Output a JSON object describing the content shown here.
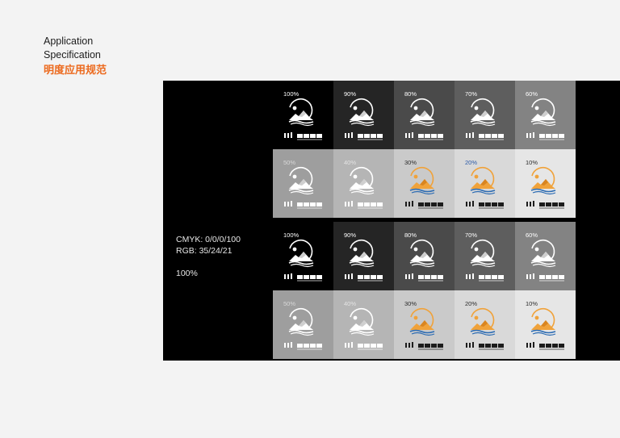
{
  "heading": {
    "line1": "Application",
    "line2": "Specification",
    "line3": "明度应用规范"
  },
  "info": {
    "cmyk": "CMYK: 0/0/0/100",
    "rgb": "RGB: 35/24/21",
    "percent": "100%"
  },
  "colors": {
    "accent": "#ec6a1e",
    "board": "#000000",
    "logo_orange": "#f0a23a",
    "logo_blue": "#2b6bb3"
  },
  "tiles": [
    {
      "label": "100%",
      "bg": "#000000",
      "label_color": "#ffffff",
      "logo": "white"
    },
    {
      "label": "90%",
      "bg": "#252525",
      "label_color": "#ffffff",
      "logo": "white"
    },
    {
      "label": "80%",
      "bg": "#4a4a4a",
      "label_color": "#ffffff",
      "logo": "white"
    },
    {
      "label": "70%",
      "bg": "#5e5e5e",
      "label_color": "#ffffff",
      "logo": "white"
    },
    {
      "label": "60%",
      "bg": "#838383",
      "label_color": "#ffffff",
      "logo": "white"
    },
    {
      "label": "50%",
      "bg": "#9e9e9e",
      "label_color": "#d8d8d8",
      "logo": "white"
    },
    {
      "label": "40%",
      "bg": "#b5b5b5",
      "label_color": "#e4e4e4",
      "logo": "white"
    },
    {
      "label": "30%",
      "bg": "#cacaca",
      "label_color": "#2b2b2b",
      "logo": "color"
    },
    {
      "label": "20%",
      "bg": "#d9d9d9",
      "label_color": "#2b5aa8",
      "logo": "color"
    },
    {
      "label": "10%",
      "bg": "#e6e6e6",
      "label_color": "#2b2b2b",
      "logo": "color"
    },
    {
      "label": "100%",
      "bg": "#000000",
      "label_color": "#ffffff",
      "logo": "white"
    },
    {
      "label": "90%",
      "bg": "#252525",
      "label_color": "#ffffff",
      "logo": "white"
    },
    {
      "label": "80%",
      "bg": "#4a4a4a",
      "label_color": "#ffffff",
      "logo": "white"
    },
    {
      "label": "70%",
      "bg": "#5e5e5e",
      "label_color": "#ffffff",
      "logo": "white"
    },
    {
      "label": "60%",
      "bg": "#838383",
      "label_color": "#ffffff",
      "logo": "white"
    },
    {
      "label": "50%",
      "bg": "#9e9e9e",
      "label_color": "#d8d8d8",
      "logo": "white"
    },
    {
      "label": "40%",
      "bg": "#b5b5b5",
      "label_color": "#e4e4e4",
      "logo": "white"
    },
    {
      "label": "30%",
      "bg": "#cacaca",
      "label_color": "#2b2b2b",
      "logo": "color"
    },
    {
      "label": "20%",
      "bg": "#d9d9d9",
      "label_color": "#2b2b2b",
      "logo": "color"
    },
    {
      "label": "10%",
      "bg": "#e6e6e6",
      "label_color": "#2b2b2b",
      "logo": "color"
    }
  ]
}
